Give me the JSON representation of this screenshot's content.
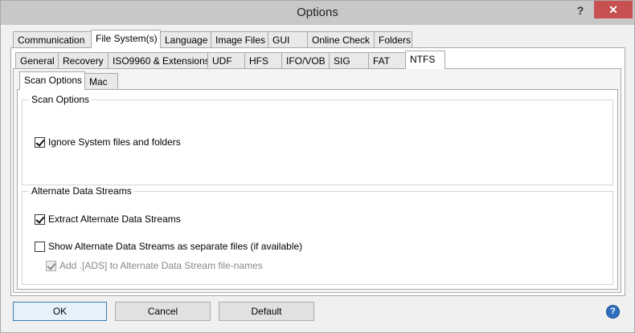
{
  "window": {
    "title": "Options"
  },
  "title_buttons": {
    "help": "?",
    "close": "✕"
  },
  "main_tabs": [
    {
      "label": "Communication",
      "active": false
    },
    {
      "label": "File System(s)",
      "active": true
    },
    {
      "label": "Language",
      "active": false
    },
    {
      "label": "Image Files",
      "active": false
    },
    {
      "label": "GUI",
      "active": false
    },
    {
      "label": "Online Check",
      "active": false
    },
    {
      "label": "Folders",
      "active": false
    }
  ],
  "fs_tabs": [
    {
      "label": "General",
      "active": false
    },
    {
      "label": "Recovery",
      "active": false
    },
    {
      "label": "ISO9960 & Extensions",
      "active": false
    },
    {
      "label": "UDF",
      "active": false
    },
    {
      "label": "HFS",
      "active": false
    },
    {
      "label": "IFO/VOB",
      "active": false
    },
    {
      "label": "SIG",
      "active": false
    },
    {
      "label": "FAT",
      "active": false
    },
    {
      "label": "NTFS",
      "active": true
    }
  ],
  "ntfs_tabs": [
    {
      "label": "Scan Options",
      "active": true
    },
    {
      "label": "Mac",
      "active": false
    }
  ],
  "scan_options": {
    "title": "Scan Options",
    "ignore_system": {
      "label": "Ignore System files and folders",
      "checked": true
    }
  },
  "ads": {
    "title": "Alternate Data Streams",
    "extract": {
      "label": "Extract Alternate Data Streams",
      "checked": true
    },
    "show_separate": {
      "label": "Show Alternate Data Streams as separate files (if available)",
      "checked": false
    },
    "add_ads": {
      "label": "Add .[ADS] to Alternate Data Stream file-names",
      "checked": true,
      "disabled": true
    }
  },
  "buttons": {
    "ok": "OK",
    "cancel": "Cancel",
    "default": "Default"
  },
  "help_icon": "?"
}
